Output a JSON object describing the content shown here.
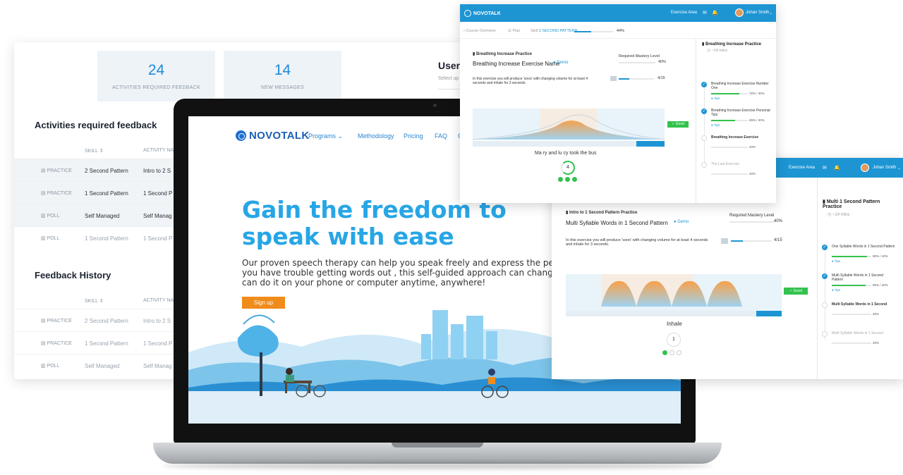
{
  "dashboard": {
    "stats": [
      {
        "value": "24",
        "label": "ACTIVITIES REQUIRED FEEDBACK"
      },
      {
        "value": "14",
        "label": "NEW MESSAGES"
      }
    ],
    "users_title": "Users",
    "users_sub": "Select up",
    "section1_title": "Activities required feedback",
    "section2_title": "Feedback History",
    "columns": {
      "skill": "SKILL ⇕",
      "activity": "ACTIVITY NA"
    },
    "rows1": [
      {
        "type": "PRACTICE",
        "skill": "2 Second Pattern",
        "activity": "Intro to 2 S"
      },
      {
        "type": "PRACTICE",
        "skill": "1 Second Pattern",
        "activity": "1 Second P"
      },
      {
        "type": "POLL",
        "skill": "Self Managed",
        "activity": "Self Manag"
      },
      {
        "type": "POLL",
        "skill": "1 Second Pattern",
        "activity": "1 Second P"
      }
    ],
    "rows2": [
      {
        "type": "PRACTICE",
        "skill": "2 Second Pattern",
        "activity": "Intro to 2 S"
      },
      {
        "type": "PRACTICE",
        "skill": "1 Second Pattern",
        "activity": "1 Second P"
      },
      {
        "type": "POLL",
        "skill": "Self Managed",
        "activity": "Self Manag"
      }
    ]
  },
  "landing": {
    "brand": "NOVOTALK",
    "nav": [
      "Programs",
      "Methodology",
      "Pricing",
      "FAQ",
      "C"
    ],
    "hero_title": "Gain the freedom to speak with ease",
    "hero_body": "Our proven speech therapy can help you speak freely and express the person you have trouble getting words out , this self-guided approach can change yo can do it on your phone or computer anytime, anywhere!",
    "signup": "Sign up"
  },
  "window_top": {
    "brand": "NOVOTALK",
    "exercise_area": "Exercise Area",
    "user_name": "Johan Smith",
    "breadcrumb": {
      "back": "Course Overview",
      "plan": "Plan",
      "skill_prefix": "Skill:",
      "skill": "2 SECOND PATTERN",
      "progress": "44%"
    },
    "practice_label": "Breathing Increase Practice",
    "exercise_title": "Breathing Increase Exercise Name",
    "demo": "Demo",
    "mastery_label": "Required Mastery Level",
    "mastery_value": "40%",
    "instructions": "In this exercise you will produce 'sooo' with changing volume for at least 4 seconds and inhale for 3 seconds.",
    "meter_value": "4/15",
    "phrase": "Ma  ry and lu cy took the bus",
    "counter": "4",
    "good": "Good",
    "side_title": "Breathing Increase Practice",
    "side_time": "~14 mins",
    "steps": [
      {
        "name": "Breathing Increase Exercise Number One",
        "score": "76% / 40%",
        "tips": "Tips",
        "fill": 0.76,
        "state": "done"
      },
      {
        "name": "Breathing Increase Exercise Personal Tips",
        "score": "65% / 40%",
        "tips": "Tips",
        "fill": 0.65,
        "state": "done"
      },
      {
        "name": "Breathing Increase Exercise",
        "score": "40%",
        "tips": "",
        "fill": 0,
        "state": "current"
      },
      {
        "name": "The Last Exercise",
        "score": "40%",
        "tips": "",
        "fill": 0,
        "state": "empty"
      }
    ]
  },
  "window_right": {
    "exercise_area": "Exercise Area",
    "user_name": "Johan Smith",
    "practice_label": "Intro to 1 Second Pattern Practice",
    "exercise_title": "Multi Syllable Words in 1 Second Pattern",
    "demo": "Demo",
    "mastery_label": "Required Mastery Level",
    "mastery_value": "40%",
    "instructions": "In this exercise you will produce 'sooo' with changing volume for at least 4 seconds and inhale for 3 seconds.",
    "meter_value": "4/15",
    "inhale": "Inhale",
    "counter": "1",
    "good": "Good",
    "side_title": "Multi 1 Second Pattern Practice",
    "side_time": "~14 mins",
    "steps": [
      {
        "name": "One Syllable Words in 1 Second Pattern",
        "score": "90% / 40%",
        "tips": "Tips",
        "fill": 0.9,
        "state": "done"
      },
      {
        "name": "Multi Syllable Words in 1 Second Pattern",
        "score": "85% / 40%",
        "tips": "Tips",
        "fill": 0.85,
        "state": "done"
      },
      {
        "name": "Multi Syllable Words in 1 Second",
        "score": "40%",
        "tips": "",
        "fill": 0,
        "state": "current"
      },
      {
        "name": "Multi Syllable Words in 1 Second",
        "score": "40%",
        "tips": "",
        "fill": 0,
        "state": "empty"
      }
    ]
  },
  "colors": {
    "accent": "#1d95d3",
    "hero": "#27a6e5",
    "signup": "#f08c1c",
    "good": "#33c24d"
  }
}
